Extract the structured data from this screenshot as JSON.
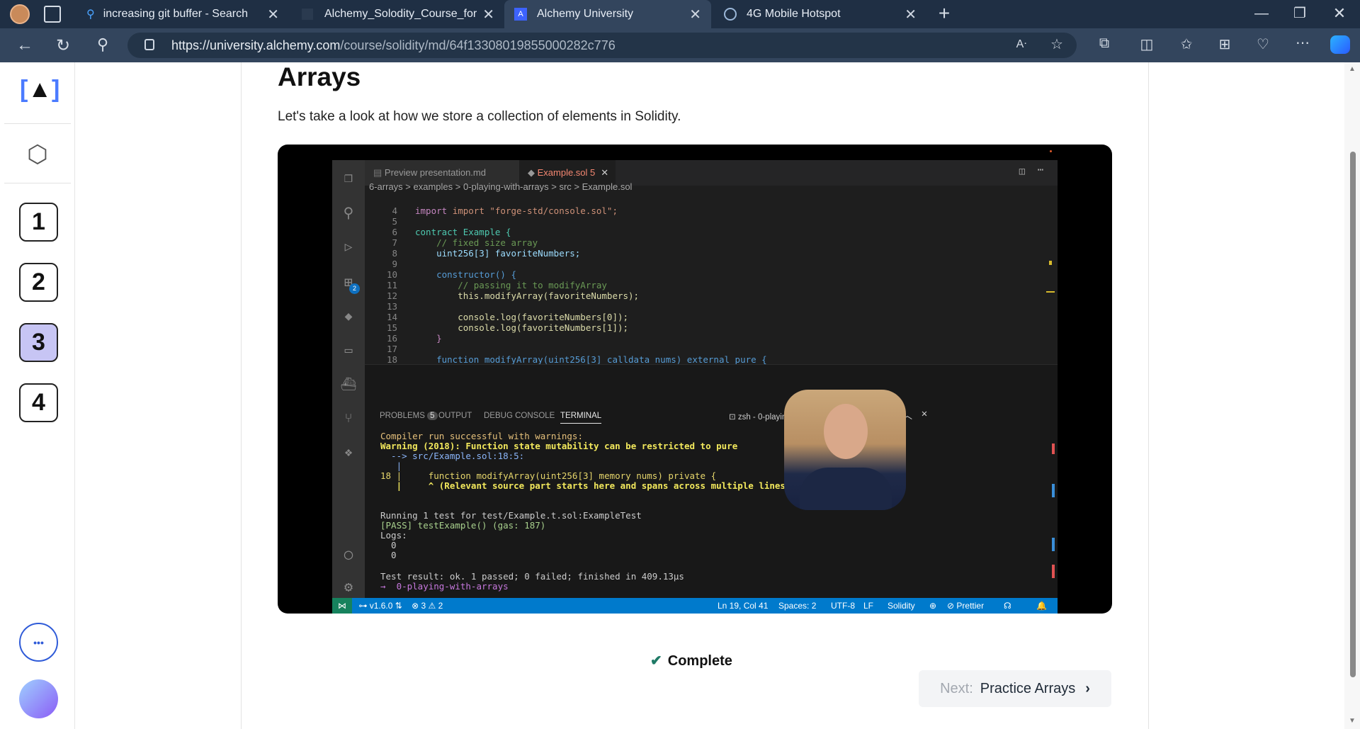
{
  "browser": {
    "tabs": [
      {
        "label": "increasing git buffer - Search",
        "icon": "search-icon"
      },
      {
        "label": "Alchemy_Solodity_Course_for_Bl",
        "icon": "file-icon"
      },
      {
        "label": "Alchemy University",
        "icon": "alchemy-icon",
        "active": true
      },
      {
        "label": "4G Mobile Hotspot",
        "icon": "globe-icon"
      }
    ],
    "url_host": "https://university.alchemy.com",
    "url_path": "/course/solidity/md/64f13308019855000282c776"
  },
  "sidebar": {
    "lessons": [
      "1",
      "2",
      "3",
      "4"
    ],
    "current": "3",
    "more": "•••"
  },
  "page": {
    "title": "Arrays",
    "intro": "Let's take a look at how we store a collection of elements in Solidity."
  },
  "editor": {
    "tabs": [
      "Preview presentation.md",
      "Example.sol 5"
    ],
    "breadcrumb": [
      "6-arrays",
      "examples",
      "0-playing-with-arrays",
      "src",
      "Example.sol"
    ],
    "lines": [
      "4",
      "5",
      "6",
      "7",
      "8",
      "9",
      "10",
      "11",
      "12",
      "13",
      "14",
      "15",
      "16",
      "17",
      "18"
    ],
    "code": [
      "import \"forge-std/console.sol\";",
      "",
      "contract Example {",
      "    // fixed size array",
      "    uint256[3] favoriteNumbers;",
      "",
      "    constructor() {",
      "        // passing it to modifyArray",
      "        this.modifyArray(favoriteNumbers);",
      "",
      "        console.log(favoriteNumbers[0]);",
      "        console.log(favoriteNumbers[1]);",
      "    }",
      "",
      "    function modifyArray(uint256[3] calldata nums) external pure {"
    ],
    "extensions_badge": "2",
    "panel_tabs": [
      "PROBLEMS",
      "OUTPUT",
      "DEBUG CONSOLE",
      "TERMINAL"
    ],
    "problems_count": "5",
    "terminal_name": "zsh - 0-playing-with-arrays",
    "terminal": [
      "Compiler run successful with warnings:",
      "Warning (2018): Function state mutability can be restricted to pure",
      "  --> src/Example.sol:18:5:",
      "   |",
      "18 |     function modifyArray(uint256[3] memory nums) private {",
      "   |     ^ (Relevant source part starts here and spans across multiple lines).",
      "",
      "",
      "Running 1 test for test/Example.t.sol:ExampleTest",
      "[PASS] testExample() (gas: 187)",
      "Logs:",
      "  0",
      "  0",
      "",
      "Test result: ok. 1 passed; 0 failed; finished in 409.13µs",
      "→  0-playing-with-arrays "
    ],
    "status": {
      "branch": "v1.6.0",
      "errors": "3",
      "warnings": "2",
      "position": "Ln 19, Col 41",
      "spaces": "Spaces: 2",
      "encoding": "UTF-8",
      "eol": "LF",
      "language": "Solidity",
      "formatter": "Prettier"
    }
  },
  "footer": {
    "complete_label": "Complete",
    "next_prefix": "Next:",
    "next_label": "Practice Arrays"
  },
  "colors": {
    "titlebar": "#1f2f44",
    "addressbar": "#33455d",
    "current_lesson": "#c7c5f4",
    "statusbar": "#007acc"
  }
}
